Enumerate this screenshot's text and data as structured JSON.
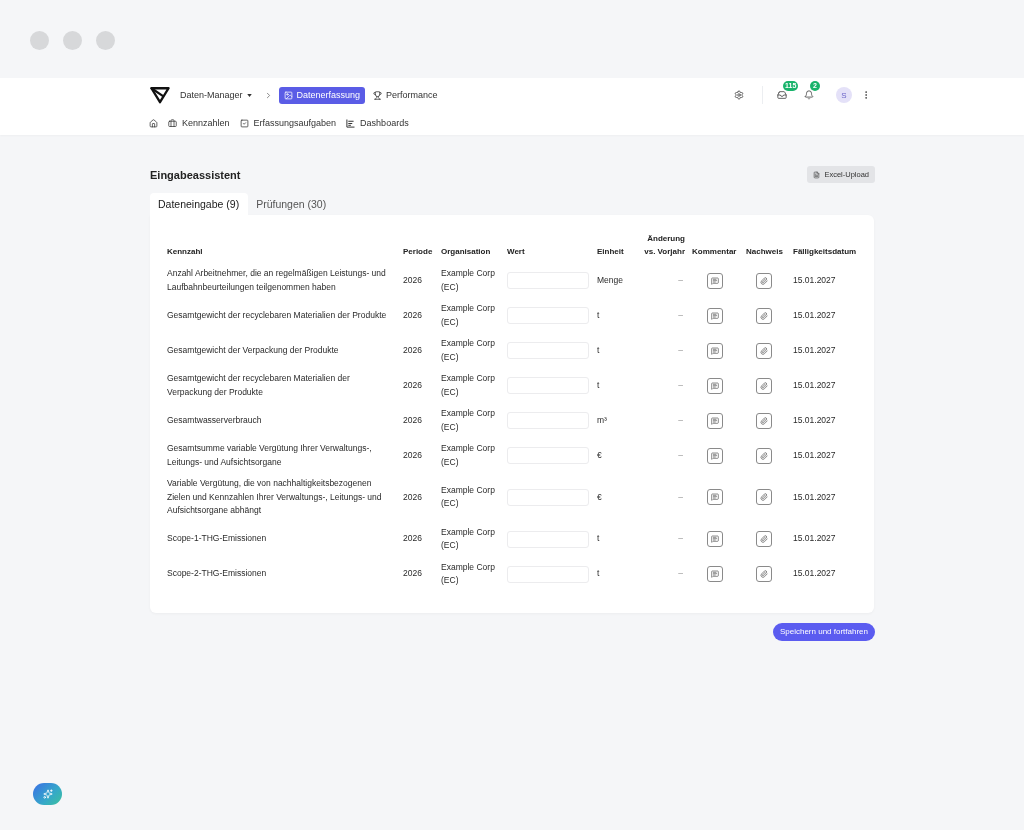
{
  "nav": {
    "workspace": "Daten-Manager",
    "tabs": [
      {
        "label": "Datenerfassung",
        "selected": true
      },
      {
        "label": "Performance",
        "selected": false
      }
    ],
    "inbox_count": "115",
    "notification_count": "2",
    "avatar": "S"
  },
  "subnav": [
    "Kennzahlen",
    "Erfassungsaufgaben",
    "Dashboards"
  ],
  "page": {
    "title": "Eingabeassistent",
    "upload_button": "Excel-Upload"
  },
  "tabs": [
    {
      "label": "Dateneingabe (9)",
      "selected": true
    },
    {
      "label": "Prüfungen (30)",
      "selected": false
    }
  ],
  "table": {
    "columns": [
      "Kennzahl",
      "Periode",
      "Organisation",
      "Wert",
      "Einheit",
      "Änderung vs. Vorjahr",
      "Kommentar",
      "Nachweis",
      "Fälligkeitsdatum"
    ],
    "rows": [
      {
        "kennzahl": "Anzahl Arbeitnehmer, die an regelmäßigen Leistungs- und Laufbahnbeurteilungen teilgenommen haben",
        "periode": "2026",
        "organisation": "Example Corp (EC)",
        "einheit": "Menge",
        "aenderung": "–",
        "faelligkeit": "15.01.2027"
      },
      {
        "kennzahl": "Gesamtgewicht der recyclebaren Materialien der Produkte",
        "periode": "2026",
        "organisation": "Example Corp (EC)",
        "einheit": "t",
        "aenderung": "–",
        "faelligkeit": "15.01.2027"
      },
      {
        "kennzahl": "Gesamtgewicht der Verpackung der Produkte",
        "periode": "2026",
        "organisation": "Example Corp (EC)",
        "einheit": "t",
        "aenderung": "–",
        "faelligkeit": "15.01.2027"
      },
      {
        "kennzahl": "Gesamtgewicht der recyclebaren Materialien der Verpackung der Produkte",
        "periode": "2026",
        "organisation": "Example Corp (EC)",
        "einheit": "t",
        "aenderung": "–",
        "faelligkeit": "15.01.2027"
      },
      {
        "kennzahl": "Gesamtwasserverbrauch",
        "periode": "2026",
        "organisation": "Example Corp (EC)",
        "einheit": "m³",
        "aenderung": "–",
        "faelligkeit": "15.01.2027"
      },
      {
        "kennzahl": "Gesamtsumme variable Vergütung Ihrer Verwaltungs-, Leitungs- und Aufsichtsorgane",
        "periode": "2026",
        "organisation": "Example Corp (EC)",
        "einheit": "€",
        "aenderung": "–",
        "faelligkeit": "15.01.2027"
      },
      {
        "kennzahl": "Variable Vergütung, die von nachhaltigkeitsbezogenen Zielen und Kennzahlen Ihrer Verwaltungs-, Leitungs- und Aufsichtsorgane abhängt",
        "periode": "2026",
        "organisation": "Example Corp (EC)",
        "einheit": "€",
        "aenderung": "–",
        "faelligkeit": "15.01.2027"
      },
      {
        "kennzahl": "Scope-1-THG-Emissionen",
        "periode": "2026",
        "organisation": "Example Corp (EC)",
        "einheit": "t",
        "aenderung": "–",
        "faelligkeit": "15.01.2027"
      },
      {
        "kennzahl": "Scope-2-THG-Emissionen",
        "periode": "2026",
        "organisation": "Example Corp (EC)",
        "einheit": "t",
        "aenderung": "–",
        "faelligkeit": "15.01.2027"
      }
    ]
  },
  "save_button": "Speichern und fortfahren"
}
